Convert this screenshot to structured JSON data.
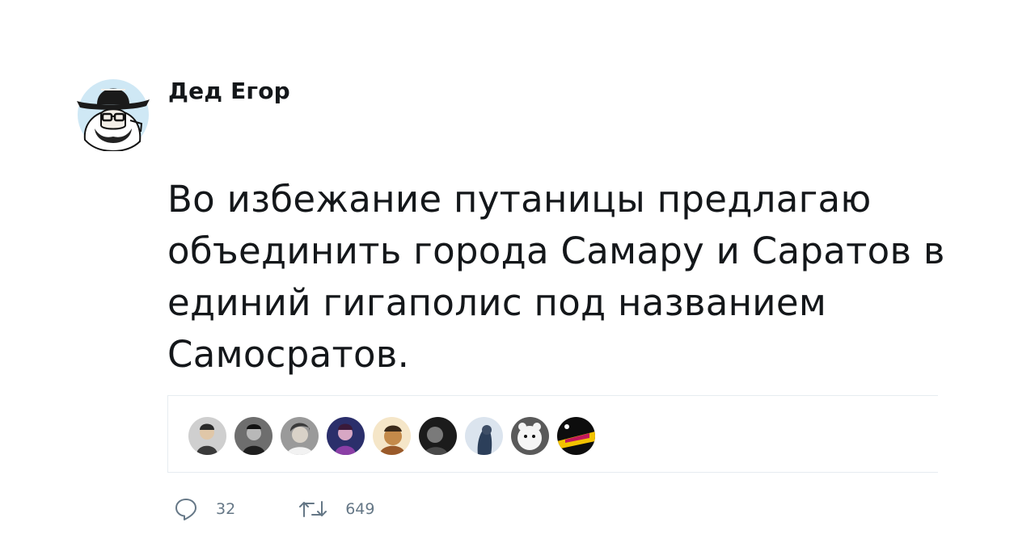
{
  "author": {
    "name": "Дед Егор",
    "avatar_icon": "bearded-man-in-hat-avatar"
  },
  "tweet": {
    "text": "Во избежание путаницы предлагаю объединить города Самару и Саратов в единий гигаполис под названием Самосратов."
  },
  "likers": [
    {
      "name": "liker-avatar-1"
    },
    {
      "name": "liker-avatar-2"
    },
    {
      "name": "liker-avatar-3"
    },
    {
      "name": "liker-avatar-4"
    },
    {
      "name": "liker-avatar-5"
    },
    {
      "name": "liker-avatar-6"
    },
    {
      "name": "liker-avatar-7"
    },
    {
      "name": "liker-avatar-8"
    },
    {
      "name": "liker-avatar-9"
    }
  ],
  "actions": {
    "replies": "32",
    "retweets": "649",
    "reply_icon": "reply-icon",
    "retweet_icon": "retweet-icon"
  },
  "colors": {
    "text": "#14171a",
    "secondary": "#657786",
    "divider": "#e6ecf0"
  }
}
